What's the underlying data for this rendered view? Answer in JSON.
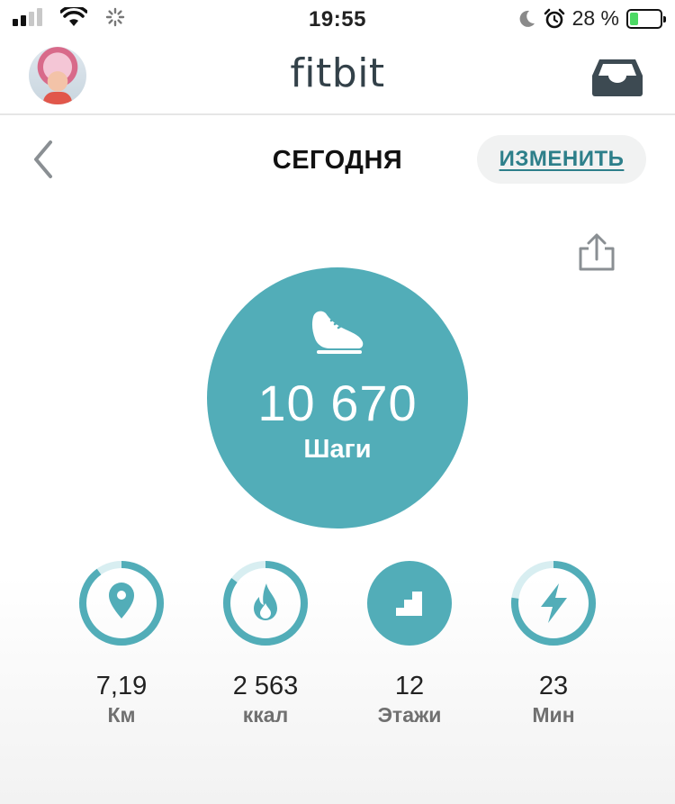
{
  "status_bar": {
    "time": "19:55",
    "battery_percent": "28 %",
    "battery_level": 0.28,
    "signal_bars_active": 2,
    "icons": [
      "signal-icon",
      "wifi-icon",
      "activity-spinner-icon",
      "moon-icon",
      "alarm-icon",
      "battery-charging-icon"
    ]
  },
  "header": {
    "logo_text": "fitbit",
    "avatar": "user-avatar",
    "inbox_icon": "inbox-icon"
  },
  "nav": {
    "title": "СЕГОДНЯ",
    "edit_label": "ИЗМЕНИТЬ",
    "back_icon": "chevron-left-icon"
  },
  "share_icon": "share-icon",
  "steps": {
    "value": "10 670",
    "label": "Шаги",
    "icon": "shoe-icon"
  },
  "stats": [
    {
      "value": "7,19",
      "label": "Км",
      "icon": "location-pin-icon",
      "progress": 0.9
    },
    {
      "value": "2 563",
      "label": "ккал",
      "icon": "flame-icon",
      "progress": 0.85
    },
    {
      "value": "12",
      "label": "Этажи",
      "icon": "stairs-icon",
      "progress": 1.0
    },
    {
      "value": "23",
      "label": "Мин",
      "icon": "lightning-icon",
      "progress": 0.77
    }
  ],
  "colors": {
    "accent": "#52adb8",
    "ring_track": "#d8eef1",
    "link": "#2d7f8a"
  }
}
